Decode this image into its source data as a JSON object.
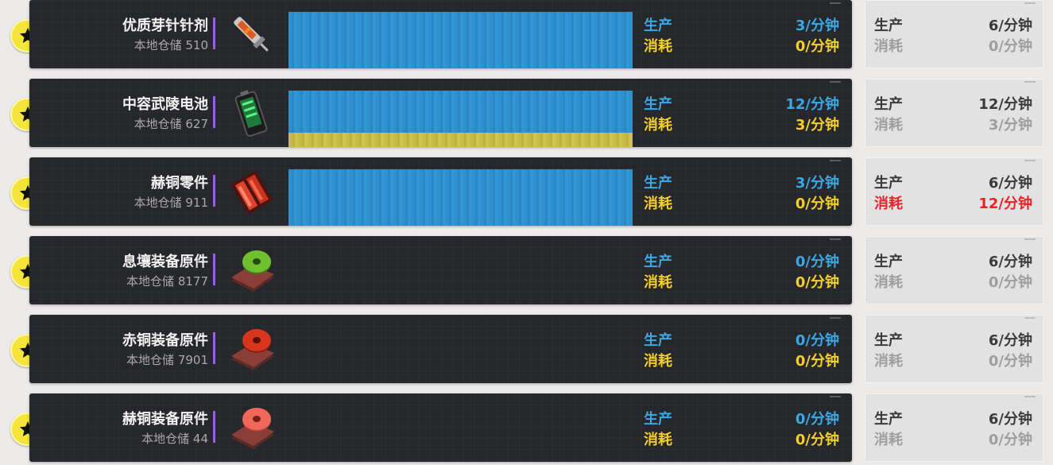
{
  "labels": {
    "production": "生产",
    "consumption": "消耗"
  },
  "colors": {
    "production": "#3aa8e6",
    "consumption": "#f3cf2a",
    "alert": "#e8232a",
    "accent": "#9b5fe0",
    "star_button": "#f5e43a"
  },
  "items": [
    {
      "name": "优质芽针针剂",
      "stock": "本地仓储 510",
      "icon": "injector-icon",
      "production_rate": "3/分钟",
      "consumption_rate": "0/分钟",
      "production_bar_fraction": 1.0,
      "consumption_bar_fraction": 0.0,
      "side_production_rate": "6/分钟",
      "side_consumption_rate": "0/分钟",
      "side_consumption_alert": false
    },
    {
      "name": "中容武陵电池",
      "stock": "本地仓储 627",
      "icon": "battery-icon",
      "production_rate": "12/分钟",
      "consumption_rate": "3/分钟",
      "production_bar_fraction": 0.75,
      "consumption_bar_fraction": 0.25,
      "side_production_rate": "12/分钟",
      "side_consumption_rate": "3/分钟",
      "side_consumption_alert": false
    },
    {
      "name": "赫铜零件",
      "stock": "本地仓储 911",
      "icon": "copper-part-icon",
      "production_rate": "3/分钟",
      "consumption_rate": "0/分钟",
      "production_bar_fraction": 1.0,
      "consumption_bar_fraction": 0.0,
      "side_production_rate": "6/分钟",
      "side_consumption_rate": "12/分钟",
      "side_consumption_alert": true
    },
    {
      "name": "息壤装备原件",
      "stock": "本地仓储 8177",
      "icon": "green-disc-component-icon",
      "production_rate": "0/分钟",
      "consumption_rate": "0/分钟",
      "production_bar_fraction": 0.0,
      "consumption_bar_fraction": 0.0,
      "side_production_rate": "6/分钟",
      "side_consumption_rate": "0/分钟",
      "side_consumption_alert": false
    },
    {
      "name": "赤铜装备原件",
      "stock": "本地仓储 7901",
      "icon": "red-disc-component-icon",
      "production_rate": "0/分钟",
      "consumption_rate": "0/分钟",
      "production_bar_fraction": 0.0,
      "consumption_bar_fraction": 0.0,
      "side_production_rate": "6/分钟",
      "side_consumption_rate": "0/分钟",
      "side_consumption_alert": false
    },
    {
      "name": "赫铜装备原件",
      "stock": "本地仓储 44",
      "icon": "pink-disc-component-icon",
      "production_rate": "0/分钟",
      "consumption_rate": "0/分钟",
      "production_bar_fraction": 0.0,
      "consumption_bar_fraction": 0.0,
      "side_production_rate": "6/分钟",
      "side_consumption_rate": "0/分钟",
      "side_consumption_alert": false
    }
  ]
}
